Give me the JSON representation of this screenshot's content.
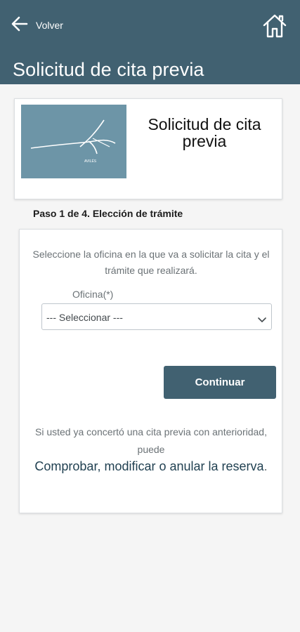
{
  "header": {
    "back_label": "Volver",
    "title": "Solicitud de cita previa",
    "background_color": "#416171"
  },
  "card": {
    "logo_text": "AVILÉS",
    "title": "Solicitud de cita previa"
  },
  "step": {
    "label": "Paso 1 de 4. Elección de trámite"
  },
  "form": {
    "instructions": "Seleccione la oficina en la que va a solicitar la cita y el trámite que realizará.",
    "office_label": "Oficina(*)",
    "office_selected": "--- Seleccionar ---",
    "continue_label": "Continuar",
    "info_text": "Si usted ya concertó una cita previa con anterioridad, puede",
    "manage_link": "Comprobar, modificar o anular la reserva",
    "manage_link_suffix": "."
  },
  "icons": {
    "back": "arrow-left-icon",
    "home": "home-icon",
    "dropdown": "chevron-down-icon"
  },
  "colors": {
    "primary": "#416171",
    "logo_bg": "#6d95a7",
    "link": "#1f3f50"
  }
}
